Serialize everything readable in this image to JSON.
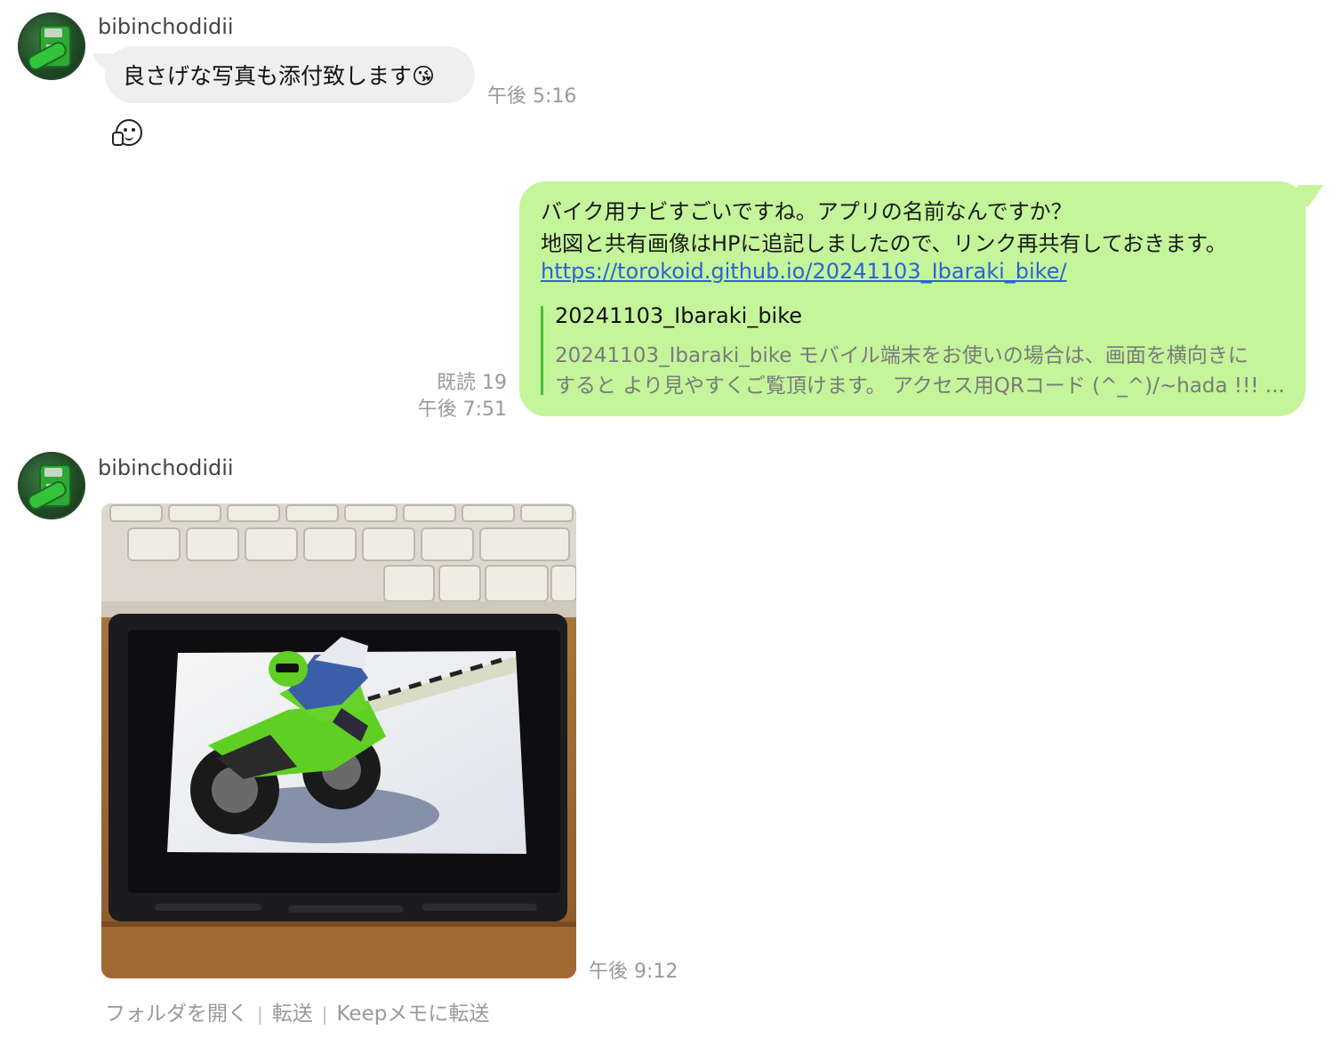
{
  "messages": [
    {
      "sender": "bibinchodidii",
      "text": "良さげな写真も添付致します😘",
      "time": "午後 5:16",
      "reaction_icon": "thinking-face-icon"
    },
    {
      "outgoing": true,
      "lines": [
        "バイク用ナビすごいですね。アプリの名前なんですか？",
        "地図と共有画像はHPに追記しましたので、リンク再共有しておきます。"
      ],
      "link": "https://torokoid.github.io/20241103_Ibaraki_bike/",
      "preview": {
        "title": "20241103_Ibaraki_bike",
        "desc_line1": "20241103_Ibaraki_bike モバイル端末をお使いの場合は、画面を横向きに",
        "desc_line2": "すると より見やすくご覧頂けます。 アクセス用QRコード (^_^)/~hada !!! ..."
      },
      "read": "既読 19",
      "time": "午後 7:51"
    },
    {
      "sender": "bibinchodidii",
      "image": "photo of motorcycle navigation device on desk",
      "time": "午後 9:12",
      "actions": [
        "フォルダを開く",
        "転送",
        "Keepメモに転送"
      ]
    }
  ],
  "colors": {
    "outgoing_bubble": "#c4f59a",
    "incoming_bubble": "#efefef",
    "link": "#2b63d8",
    "muted": "#9a9a9a"
  }
}
